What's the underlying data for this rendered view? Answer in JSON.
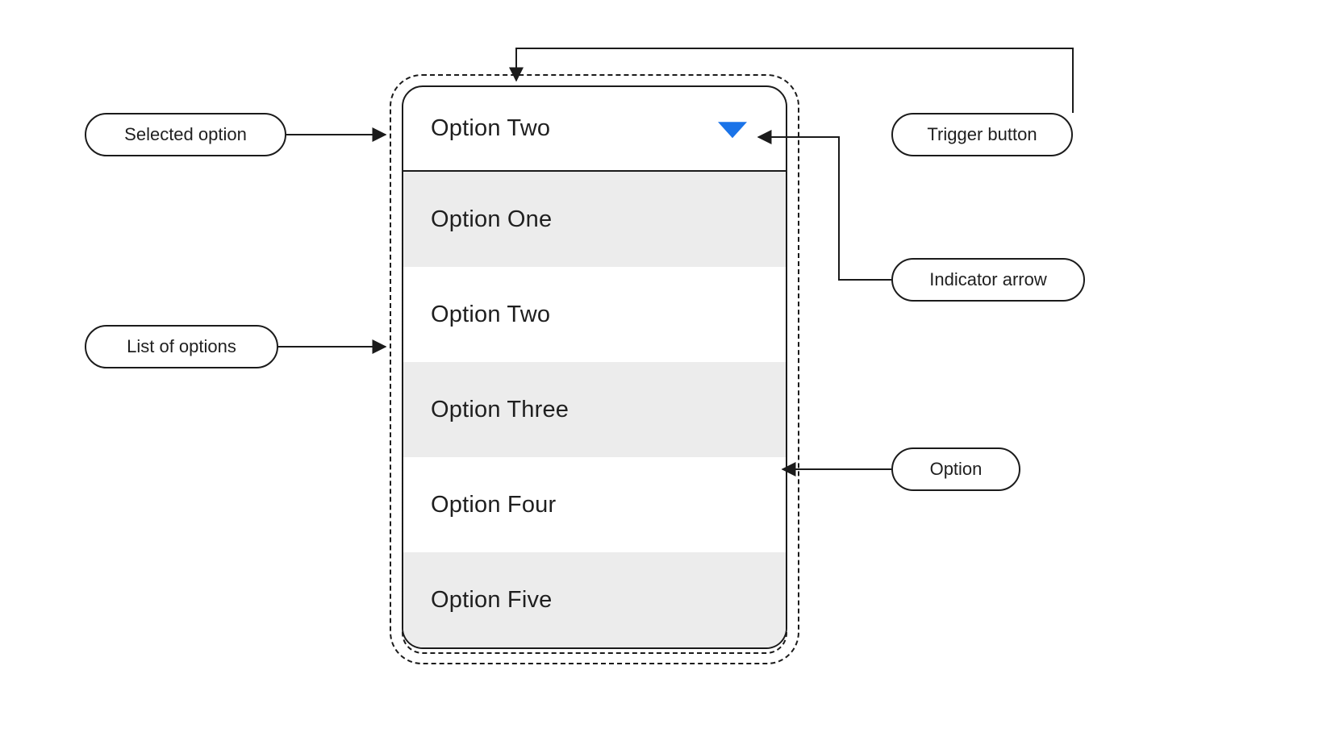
{
  "dropdown": {
    "selected_label": "Option Two",
    "options": [
      "Option One",
      "Option Two",
      "Option Three",
      "Option  Four",
      "Option Five"
    ]
  },
  "callouts": {
    "selected_option": "Selected option",
    "list_of_options": "List of options",
    "trigger_button": "Trigger button",
    "indicator_arrow": "Indicator arrow",
    "option": "Option"
  },
  "colors": {
    "highlight_blue": "#8ab4f8",
    "arrow_blue": "#1a73e8",
    "stripe_grey": "#ececec"
  }
}
